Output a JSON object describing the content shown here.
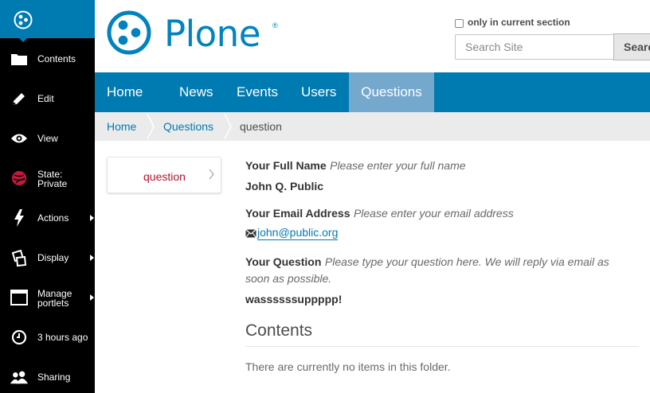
{
  "toolbar": {
    "items": [
      {
        "label": "Contents",
        "icon": "folder-icon"
      },
      {
        "label": "Edit",
        "icon": "pencil-icon"
      },
      {
        "label": "View",
        "icon": "eye-icon"
      },
      {
        "label_line1": "State:",
        "label_line2": "Private",
        "icon": "state-icon"
      },
      {
        "label": "Actions",
        "icon": "lightning-icon"
      },
      {
        "label": "Display",
        "icon": "display-icon"
      },
      {
        "label_line1": "Manage",
        "label_line2": "portlets",
        "icon": "portlets-icon"
      },
      {
        "label": "3 hours ago",
        "icon": "clock-icon"
      },
      {
        "label": "Sharing",
        "icon": "users-icon"
      }
    ]
  },
  "header": {
    "logo_text": "Plone",
    "logo_reg": "®",
    "section_checkbox_label": "only in current section",
    "section_checkbox_checked": false,
    "search_placeholder": "Search Site",
    "search_button": "Search"
  },
  "nav": {
    "items": [
      "Home",
      "News",
      "Events",
      "Users",
      "Questions"
    ],
    "active": "Questions"
  },
  "breadcrumbs": [
    "Home",
    "Questions",
    "question"
  ],
  "portlet": {
    "link": "question"
  },
  "form": {
    "name_label": "Your Full Name",
    "name_help": "Please enter your full name",
    "name_value": "John Q. Public",
    "email_label": "Your Email Address",
    "email_help": "Please enter your email address",
    "email_value": "john@public.org",
    "question_label": "Your Question",
    "question_help": "Please type your question here. We will reply via email as soon as possible.",
    "question_value": "wassssssuppppp!"
  },
  "contents": {
    "heading": "Contents",
    "empty_message": "There are currently no items in this folder."
  },
  "colors": {
    "plone_blue": "#007bb1",
    "nav_active": "#75a8cd",
    "toolbar_bg": "#000000",
    "state_private": "#c4183c"
  }
}
